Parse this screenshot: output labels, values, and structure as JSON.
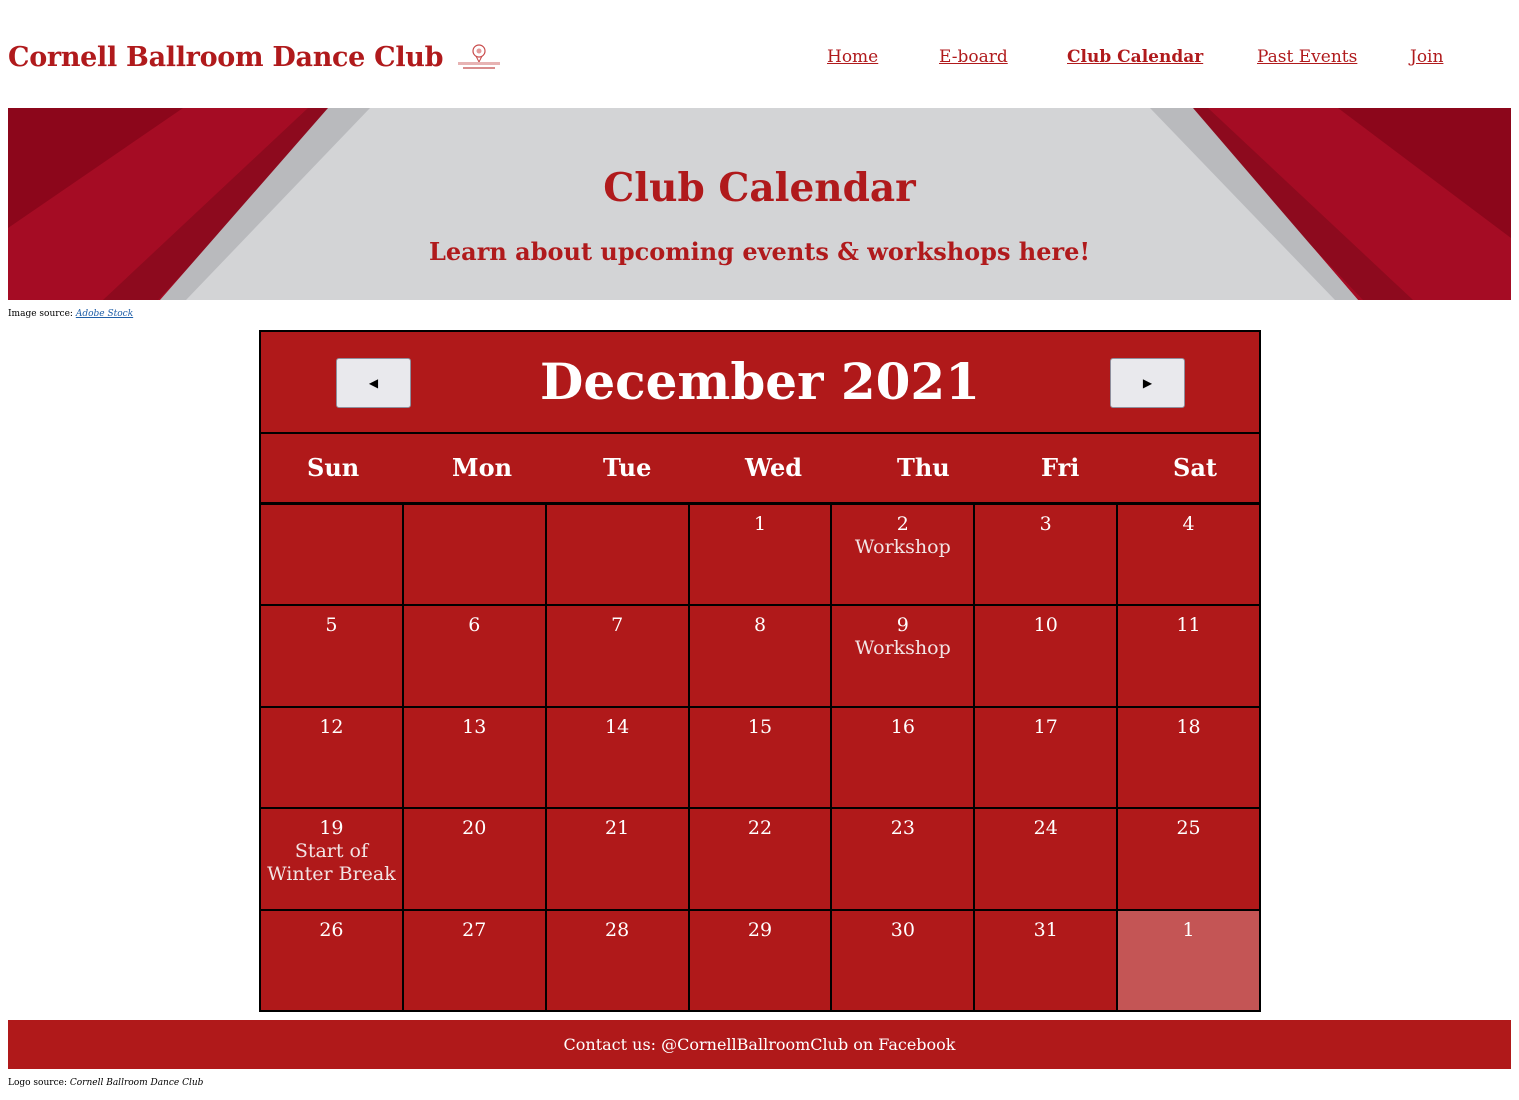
{
  "site": {
    "title": "Cornell Ballroom Dance Club",
    "logo_text": "Cornell Ballroom Dance Club"
  },
  "nav": {
    "items": [
      {
        "label": "Home"
      },
      {
        "label": "E-board"
      },
      {
        "label": "Club Calendar",
        "active": true
      },
      {
        "label": "Past Events"
      },
      {
        "label": "Join"
      }
    ]
  },
  "hero": {
    "title": "Club Calendar",
    "subtitle": "Learn about upcoming events & workshops here!"
  },
  "image_source": {
    "label": "Image source:",
    "link_text": "Adobe Stock"
  },
  "calendar": {
    "month_title": "December 2021",
    "prev_label": "◀",
    "next_label": "▶",
    "weekdays": [
      "Sun",
      "Mon",
      "Tue",
      "Wed",
      "Thu",
      "Fri",
      "Sat"
    ],
    "weeks": [
      [
        {
          "day": ""
        },
        {
          "day": ""
        },
        {
          "day": ""
        },
        {
          "day": "1"
        },
        {
          "day": "2",
          "event": "Workshop"
        },
        {
          "day": "3"
        },
        {
          "day": "4"
        }
      ],
      [
        {
          "day": "5"
        },
        {
          "day": "6"
        },
        {
          "day": "7"
        },
        {
          "day": "8"
        },
        {
          "day": "9",
          "event": "Workshop"
        },
        {
          "day": "10"
        },
        {
          "day": "11"
        }
      ],
      [
        {
          "day": "12"
        },
        {
          "day": "13"
        },
        {
          "day": "14"
        },
        {
          "day": "15"
        },
        {
          "day": "16"
        },
        {
          "day": "17"
        },
        {
          "day": "18"
        }
      ],
      [
        {
          "day": "19",
          "event": "Start of Winter Break"
        },
        {
          "day": "20"
        },
        {
          "day": "21"
        },
        {
          "day": "22"
        },
        {
          "day": "23"
        },
        {
          "day": "24"
        },
        {
          "day": "25"
        }
      ],
      [
        {
          "day": "26"
        },
        {
          "day": "27"
        },
        {
          "day": "28"
        },
        {
          "day": "29"
        },
        {
          "day": "30"
        },
        {
          "day": "31"
        },
        {
          "day": "1",
          "other_month": true
        }
      ]
    ]
  },
  "footer": {
    "contact": "Contact us: @CornellBallroomClub on Facebook"
  },
  "logo_source": {
    "label": "Logo source:",
    "credit": "Cornell Ballroom Dance Club"
  },
  "colors": {
    "brand_red": "#b0191a",
    "hero_gray": "#d3d4d6",
    "faded_cell": "#c45555"
  }
}
